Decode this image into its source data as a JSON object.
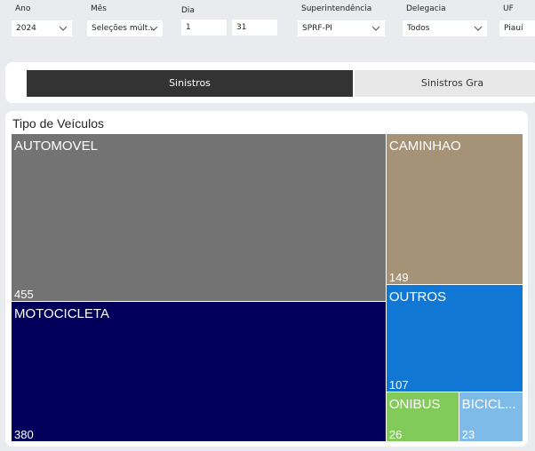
{
  "filters": [
    {
      "label": "Ano",
      "value": "2024"
    },
    {
      "label": "Mês",
      "value": "Seleções múlt..."
    },
    {
      "label": "Dia",
      "from": "1",
      "to": "31"
    },
    {
      "label": "Superintendência",
      "value": "SPRF-PI"
    },
    {
      "label": "Delegacia",
      "value": "Todos"
    },
    {
      "label": "UF",
      "value": "Piauí"
    }
  ],
  "tabs": [
    {
      "label": "Sinistros",
      "active": true
    },
    {
      "label": "Sinistros Gra",
      "active": false
    }
  ],
  "treemap": {
    "title": "Tipo de Veículos",
    "chart_data": {
      "type": "treemap",
      "items": [
        {
          "name": "AUTOMOVEL",
          "value": 455,
          "color": "#737373"
        },
        {
          "name": "MOTOCICLETA",
          "value": 380,
          "color": "#00005a"
        },
        {
          "name": "CAMINHAO",
          "value": 149,
          "color": "#a59277"
        },
        {
          "name": "OUTROS",
          "value": 107,
          "color": "#1177d4"
        },
        {
          "name": "ONIBUS",
          "value": 26,
          "color": "#82ca5a"
        },
        {
          "name": "BICICL...",
          "value": 23,
          "color": "#7fbbe8"
        }
      ]
    }
  }
}
